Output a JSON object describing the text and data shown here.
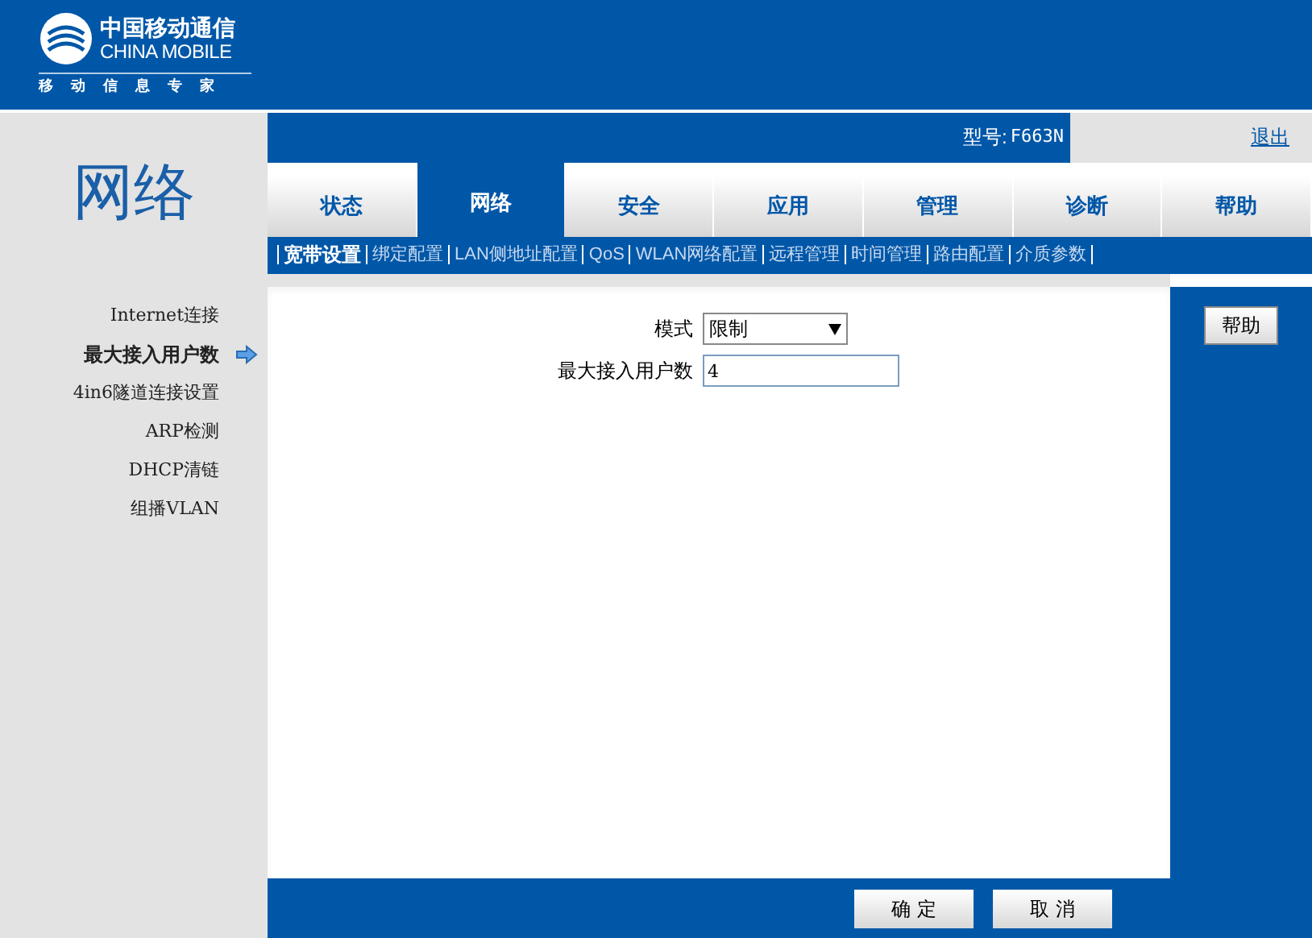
{
  "logo": {
    "name_cn": "中国移动通信",
    "name_en": "CHINA MOBILE",
    "slogan": [
      "移",
      "动",
      "信",
      "息",
      "专",
      "家"
    ]
  },
  "section_title": "网络",
  "model": {
    "label": "型号:",
    "value": "F663N"
  },
  "logout": "退出",
  "tabs": [
    {
      "label": "状态",
      "selected": false
    },
    {
      "label": "网络",
      "selected": true
    },
    {
      "label": "安全",
      "selected": false
    },
    {
      "label": "应用",
      "selected": false
    },
    {
      "label": "管理",
      "selected": false
    },
    {
      "label": "诊断",
      "selected": false
    },
    {
      "label": "帮助",
      "selected": false
    }
  ],
  "subnav": [
    {
      "label": "宽带设置",
      "selected": true
    },
    {
      "label": "绑定配置",
      "selected": false
    },
    {
      "label": "LAN侧地址配置",
      "selected": false
    },
    {
      "label": "QoS",
      "selected": false
    },
    {
      "label": "WLAN网络配置",
      "selected": false
    },
    {
      "label": "远程管理",
      "selected": false
    },
    {
      "label": "时间管理",
      "selected": false
    },
    {
      "label": "路由配置",
      "selected": false
    },
    {
      "label": "介质参数",
      "selected": false
    }
  ],
  "sidebar": [
    {
      "label": "Internet连接",
      "selected": false
    },
    {
      "label": "最大接入用户数",
      "selected": true
    },
    {
      "label": "4in6隧道连接设置",
      "selected": false
    },
    {
      "label": "ARP检测",
      "selected": false
    },
    {
      "label": "DHCP清链",
      "selected": false
    },
    {
      "label": "组播VLAN",
      "selected": false
    }
  ],
  "form": [
    {
      "kind": "select",
      "label": "模式",
      "value": "限制"
    },
    {
      "kind": "text",
      "label": "最大接入用户数",
      "value": "4"
    }
  ],
  "help_button": "帮助",
  "buttons": [
    "确 定",
    "取 消"
  ]
}
